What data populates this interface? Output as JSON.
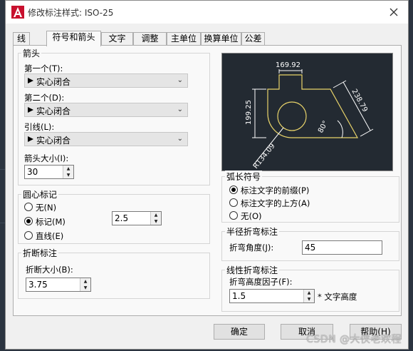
{
  "window": {
    "title": "修改标注样式: ISO-25"
  },
  "tabs": [
    "线",
    "符号和箭头",
    "文字",
    "调整",
    "主单位",
    "换算单位",
    "公差"
  ],
  "arrowheads": {
    "group_label": "箭头",
    "first_label": "第一个(T):",
    "first_value": "实心闭合",
    "second_label": "第二个(D):",
    "second_value": "实心闭合",
    "leader_label": "引线(L):",
    "leader_value": "实心闭合",
    "size_label": "箭头大小(I):",
    "size_value": "30"
  },
  "center_marks": {
    "group_label": "圆心标记",
    "none_label": "无(N)",
    "mark_label": "标记(M)",
    "line_label": "直线(E)",
    "selected": "mark",
    "size_value": "2.5"
  },
  "break": {
    "group_label": "折断标注",
    "size_label": "折断大小(B):",
    "size_value": "3.75"
  },
  "preview": {
    "dim_top": "169.92",
    "dim_left": "199.25",
    "dim_diag": "238.79",
    "dim_angle": "80°",
    "dim_radius": "R134.09"
  },
  "arc_symbol": {
    "group_label": "弧长符号",
    "before_label": "标注文字的前缀(P)",
    "above_label": "标注文字的上方(A)",
    "none_label": "无(O)",
    "selected": "before"
  },
  "radius_jog": {
    "group_label": "半径折弯标注",
    "angle_label": "折弯角度(J):",
    "angle_value": "45"
  },
  "linear_jog": {
    "group_label": "线性折弯标注",
    "factor_label": "折弯高度因子(F):",
    "factor_value": "1.5",
    "unit_label": "* 文字高度"
  },
  "buttons": {
    "ok": "确定",
    "cancel": "取消",
    "help": "帮助(H)"
  },
  "watermark": "CSDN @大侠老欢程",
  "colors": {
    "preview_bg": "#232a32",
    "preview_lines": "#e8d36a",
    "preview_text": "#ffffff"
  }
}
